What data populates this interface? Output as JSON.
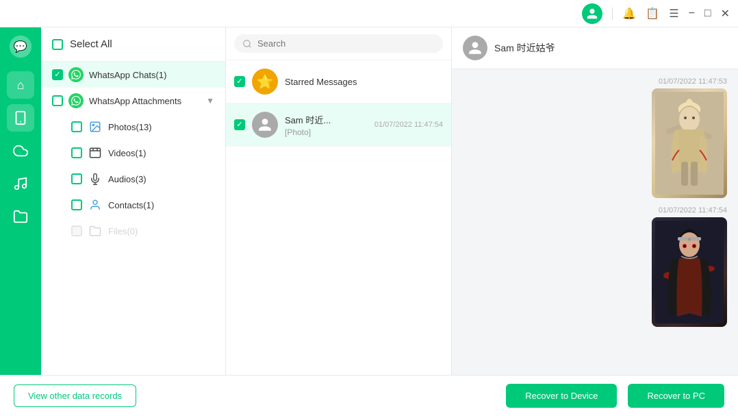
{
  "titlebar": {
    "minimize_label": "−",
    "maximize_label": "□",
    "close_label": "✕",
    "menu_label": "☰"
  },
  "nav": {
    "items": [
      {
        "id": "home",
        "icon": "⌂",
        "label": "Home"
      },
      {
        "id": "device",
        "icon": "📱",
        "label": "Device",
        "active": true
      },
      {
        "id": "cloud",
        "icon": "☁",
        "label": "Cloud"
      },
      {
        "id": "music",
        "icon": "♪",
        "label": "Music"
      },
      {
        "id": "files",
        "icon": "📁",
        "label": "Files"
      }
    ]
  },
  "left_panel": {
    "select_all_label": "Select All",
    "items": [
      {
        "id": "whatsapp-chats",
        "label": "WhatsApp Chats(1)",
        "type": "whatsapp",
        "checked": true,
        "indent": 0
      },
      {
        "id": "whatsapp-attachments",
        "label": "WhatsApp Attachments",
        "type": "whatsapp",
        "checked": false,
        "hasArrow": true,
        "indent": 0
      },
      {
        "id": "photos",
        "label": "Photos(13)",
        "type": "photo",
        "checked": false,
        "indent": 1
      },
      {
        "id": "videos",
        "label": "Videos(1)",
        "type": "video",
        "checked": false,
        "indent": 1
      },
      {
        "id": "audios",
        "label": "Audios(3)",
        "type": "audio",
        "checked": false,
        "indent": 1
      },
      {
        "id": "contacts",
        "label": "Contacts(1)",
        "type": "contact",
        "checked": false,
        "indent": 1
      },
      {
        "id": "files",
        "label": "Files(0)",
        "type": "file",
        "checked": false,
        "disabled": true,
        "indent": 1
      }
    ]
  },
  "middle_panel": {
    "search_placeholder": "Search",
    "conversations": [
      {
        "id": "starred",
        "name": "Starred Messages",
        "avatar_type": "star",
        "time": "",
        "preview": "",
        "checked": true
      },
      {
        "id": "sam",
        "name": "Sam 时近...",
        "avatar_type": "person",
        "time": "01/07/2022 11:47:54",
        "preview": "[Photo]",
        "checked": true
      }
    ]
  },
  "right_panel": {
    "chat_name": "Sam 时近姑爷",
    "messages": [
      {
        "timestamp": "01/07/2022 11:47:53",
        "type": "image",
        "image_theme": "light"
      },
      {
        "timestamp": "01/07/2022 11:47:54",
        "type": "image",
        "image_theme": "dark"
      }
    ]
  },
  "bottom_bar": {
    "view_other_label": "View other data records",
    "recover_device_label": "Recover to Device",
    "recover_pc_label": "Recover to PC"
  }
}
